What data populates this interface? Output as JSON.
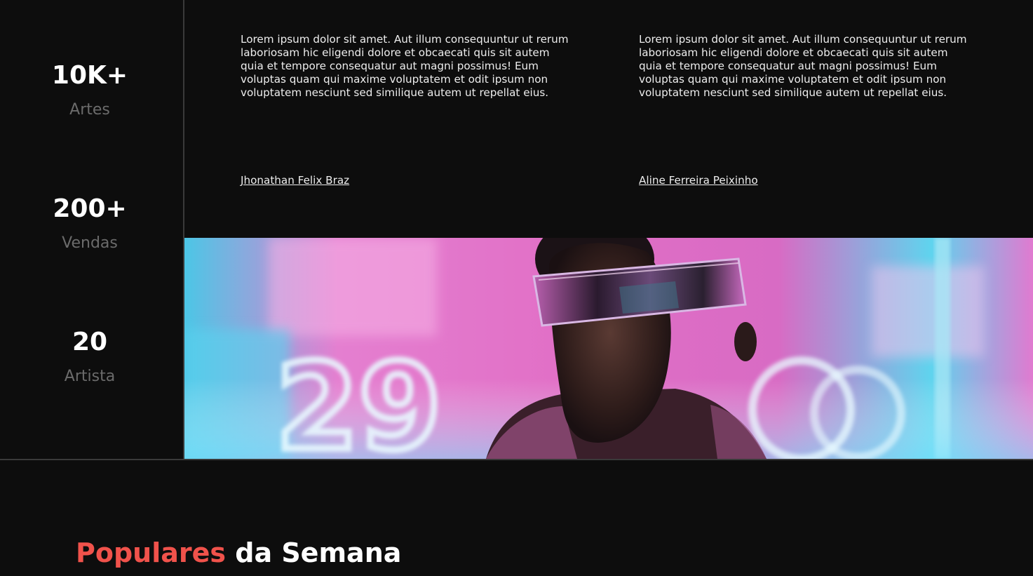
{
  "stats": [
    {
      "value": "10K+",
      "label": "Artes"
    },
    {
      "value": "200+",
      "label": "Vendas"
    },
    {
      "value": "20",
      "label": "Artista"
    }
  ],
  "testimonials": [
    {
      "text": "Lorem ipsum dolor sit amet. Aut illum consequuntur ut rerum laboriosam hic eligendi dolore et obcaecati quis sit autem quia et tempore consequatur aut magni possimus! Eum voluptas quam qui maxime voluptatem et odit ipsum non voluptatem nesciunt sed similique autem ut repellat eius.",
      "author": "Jhonathan Felix Braz"
    },
    {
      "text": "Lorem ipsum dolor sit amet. Aut illum consequuntur ut rerum laboriosam hic eligendi dolore et obcaecati quis sit autem quia et tempore consequatur aut magni possimus! Eum voluptas quam qui maxime voluptatem et odit ipsum non voluptatem nesciunt sed similique autem ut repellat eius.",
      "author": "Aline Ferreira Peixinho"
    }
  ],
  "banner": {
    "neon_text": "29",
    "colors": {
      "pink": "#e86ac8",
      "cyan": "#4fd6f0",
      "magenta": "#c43f9a"
    }
  },
  "section": {
    "title_accent": "Populares",
    "title_rest": " da Semana",
    "accent_color": "#f0524b"
  }
}
